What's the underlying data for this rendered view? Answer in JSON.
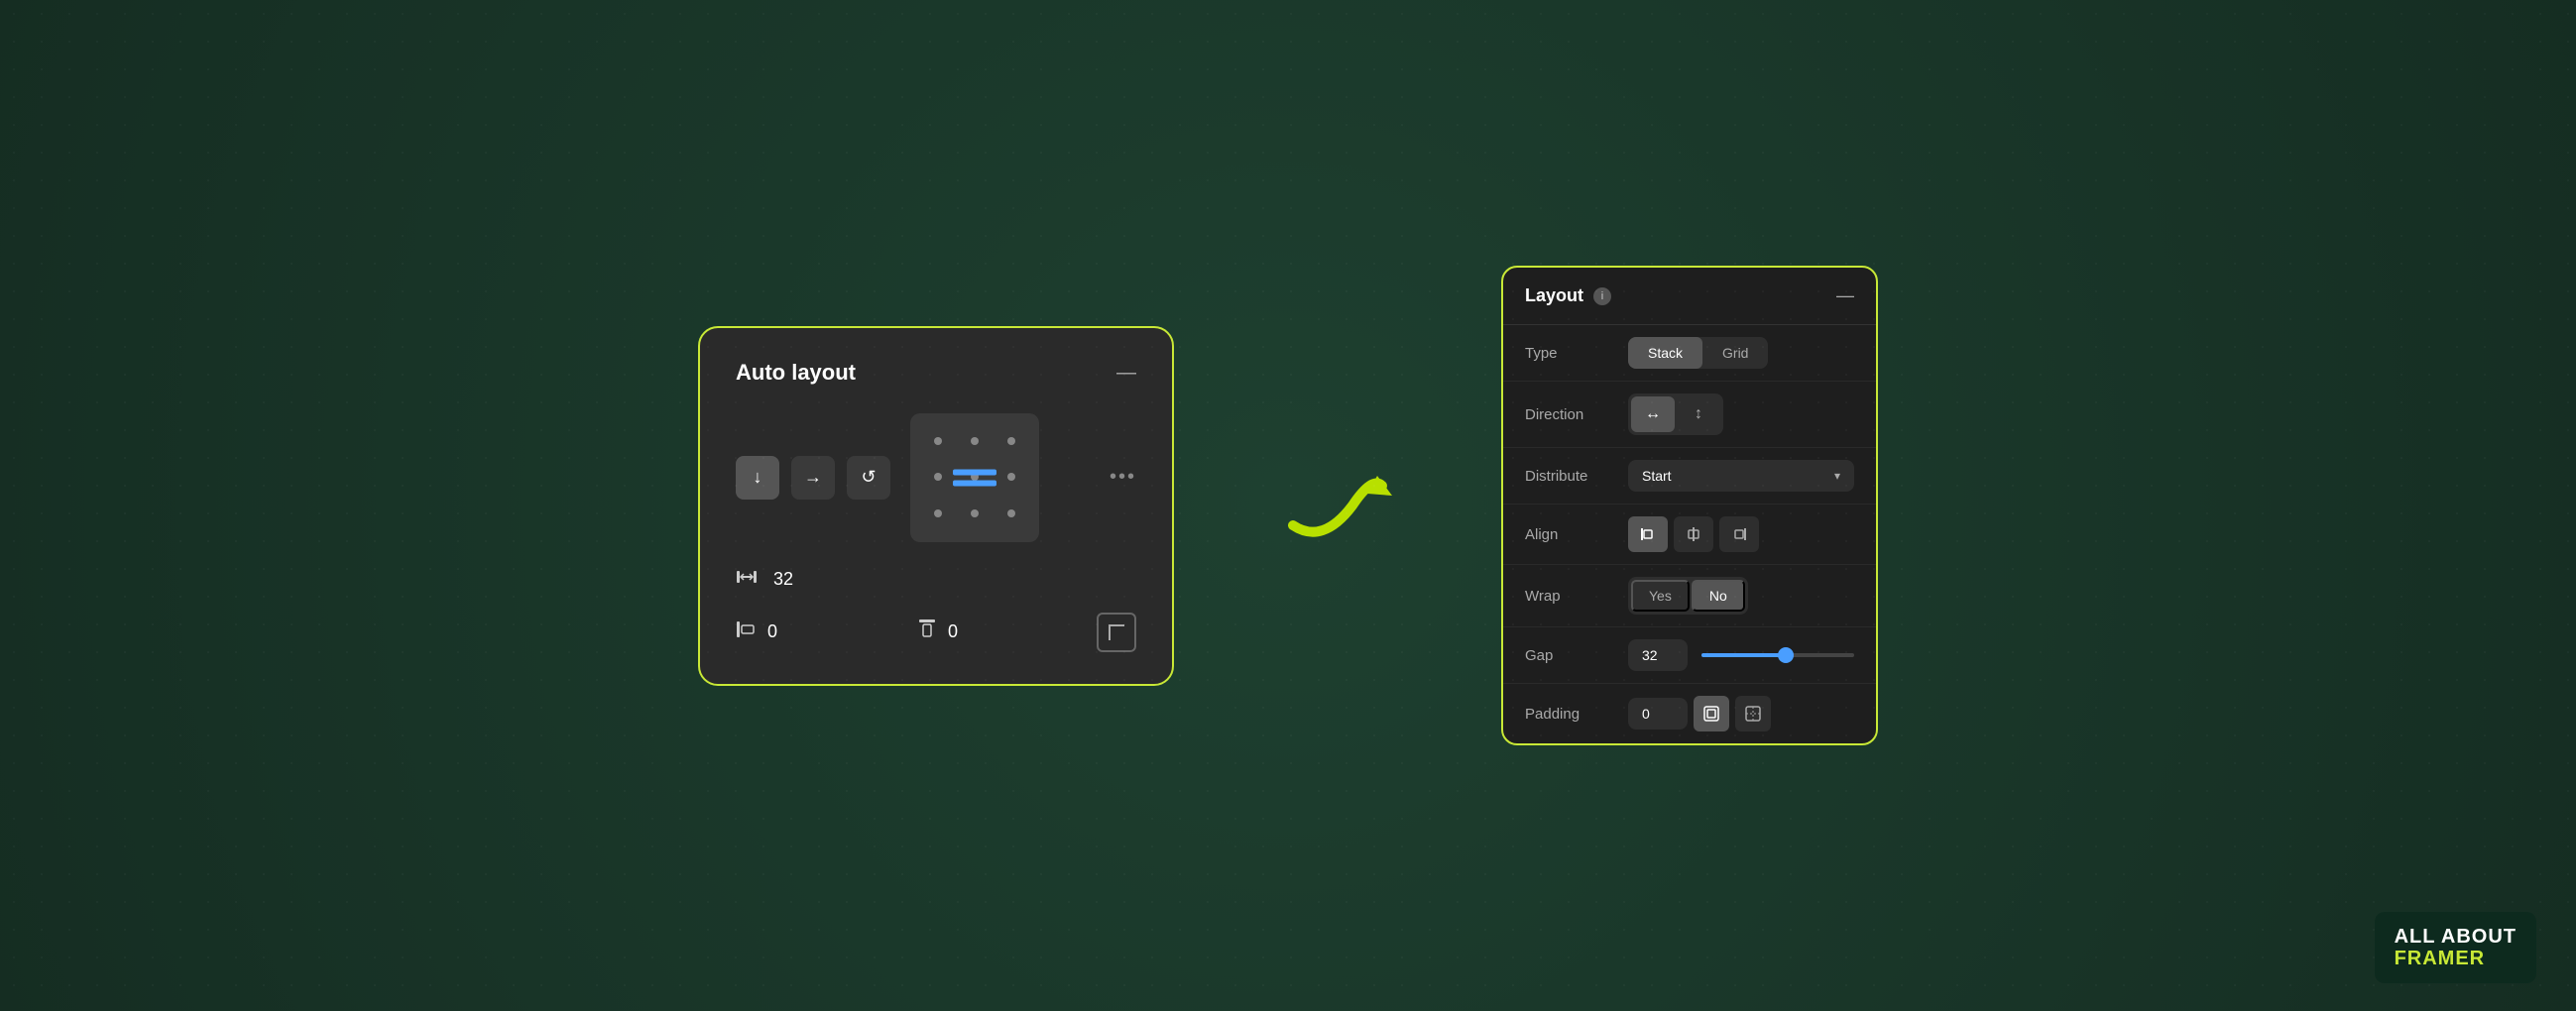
{
  "background": {
    "color": "#1a3a2a"
  },
  "auto_layout_card": {
    "title": "Auto layout",
    "minimize": "—",
    "direction_buttons": [
      {
        "label": "↓",
        "active": true
      },
      {
        "label": "→",
        "active": false
      },
      {
        "label": "↺",
        "active": false
      }
    ],
    "three_dots": "•••",
    "gap_label": "gap-icon",
    "gap_value": "32",
    "padding_left_value": "0",
    "padding_top_value": "0"
  },
  "layout_panel": {
    "title": "Layout",
    "minimize": "—",
    "info_icon": "i",
    "rows": [
      {
        "label": "Type",
        "stack_label": "Stack",
        "grid_label": "Grid"
      },
      {
        "label": "Direction",
        "h_arrow": "↔",
        "v_arrow": "↕"
      },
      {
        "label": "Distribute",
        "value": "Start",
        "dropdown_arrow": "▾"
      },
      {
        "label": "Align",
        "buttons": [
          "align-left",
          "align-center",
          "align-right"
        ]
      },
      {
        "label": "Wrap",
        "yes": "Yes",
        "no": "No"
      },
      {
        "label": "Gap",
        "value": "32",
        "slider_percent": 55
      },
      {
        "label": "Padding",
        "value": "0"
      }
    ]
  },
  "branding": {
    "line1": "ALL ABOUT",
    "line2": "FRAMER"
  }
}
